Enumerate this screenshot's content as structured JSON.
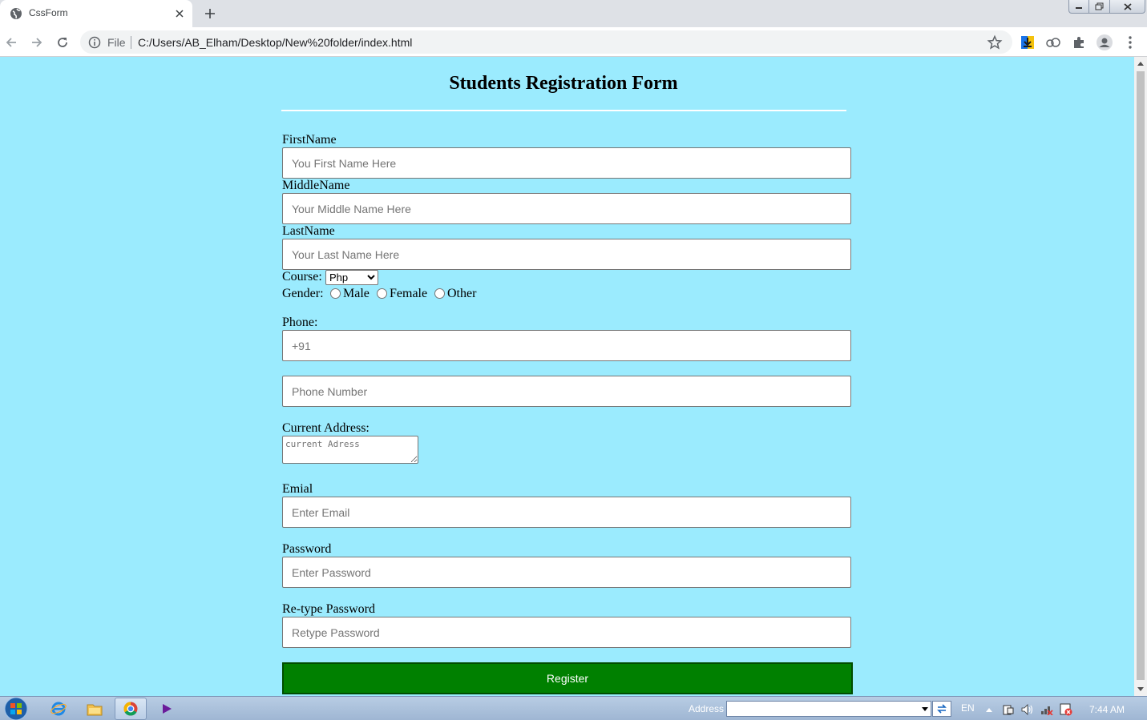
{
  "browser": {
    "tab_title": "CssForm",
    "omnibox_scheme": "File",
    "url": "C:/Users/AB_Elham/Desktop/New%20folder/index.html"
  },
  "form": {
    "title": "Students Registration Form",
    "first_name_label": "FirstName",
    "first_name_placeholder": "You First Name Here",
    "middle_name_label": "MiddleName",
    "middle_name_placeholder": "Your Middle Name Here",
    "last_name_label": "LastName",
    "last_name_placeholder": "Your Last Name Here",
    "course_label": "Course:",
    "course_selected": "Php",
    "gender_label": "Gender:",
    "gender_options": [
      "Male",
      "Female",
      "Other"
    ],
    "phone_label": "Phone:",
    "phone_code_placeholder": "+91",
    "phone_number_placeholder": "Phone Number",
    "address_label": "Current Address:",
    "address_placeholder": "current Adress",
    "email_label": "Emial",
    "email_placeholder": "Enter Email",
    "password_label": "Password",
    "password_placeholder": "Enter Password",
    "retype_label": "Re-type Password",
    "retype_placeholder": "Retype Password",
    "register_label": "Register"
  },
  "taskbar": {
    "address_label": "Address",
    "language": "EN",
    "clock": "7:44 AM"
  },
  "colors": {
    "page_background": "#9bebfe",
    "register_button": "#008000"
  }
}
